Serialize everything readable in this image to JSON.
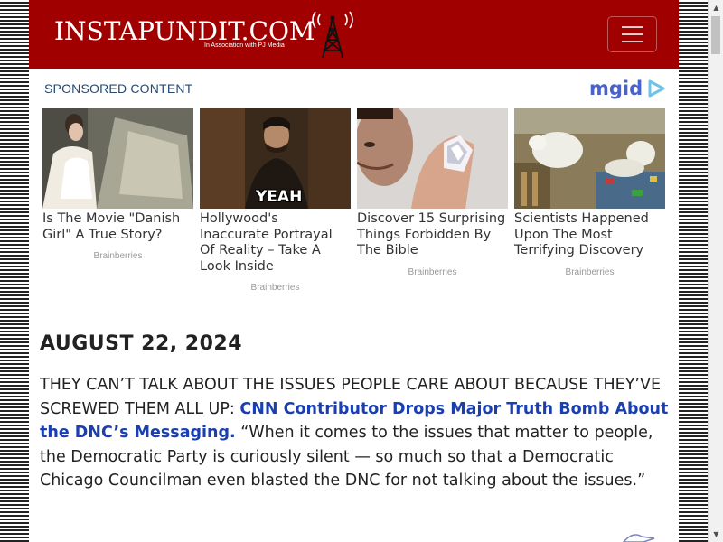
{
  "header": {
    "logo_text": "INSTAPUNDIT.COM",
    "logo_subtext": "In Association with PJ Media",
    "bg_color": "#a00000"
  },
  "sponsored": {
    "heading": "SPONSORED CONTENT",
    "brand": "mgid",
    "cards": [
      {
        "title": "Is The Movie \"Danish Girl\" A True Story?",
        "source": "Brainberries"
      },
      {
        "title": "Hollywood's Inaccurate Portrayal Of Reality – Take A Look Inside",
        "source": "Brainberries",
        "image_caption": "YEAH"
      },
      {
        "title": "Discover 15 Surprising Things Forbidden By The Bible",
        "source": "Brainberries"
      },
      {
        "title": "Scientists Happened Upon The Most Terrifying Discovery",
        "source": "Brainberries"
      }
    ]
  },
  "post": {
    "date": "AUGUST 22, 2024",
    "lead": "THEY CAN’T TALK ABOUT THE ISSUES PEOPLE CARE ABOUT BECAUSE THEY’VE SCREWED THEM ALL UP:",
    "link_text": "CNN Contributor Drops Major Truth Bomb About the DNC’s Messaging.",
    "quote": "“When it comes to the issues that matter to people, the Democratic Party is curiously silent — so much so that a Democratic Chicago Councilman even blasted the DNC for not talking about the issues.”"
  }
}
